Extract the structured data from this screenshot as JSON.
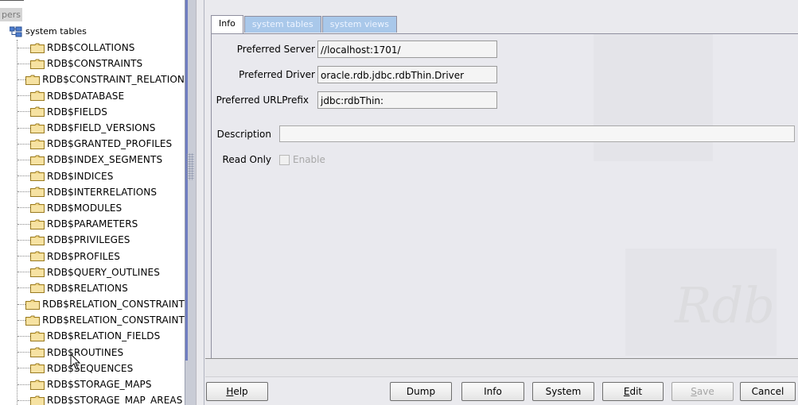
{
  "tree": {
    "pers_label": "pers",
    "root_label": "system tables",
    "items": [
      "RDB$COLLATIONS",
      "RDB$CONSTRAINTS",
      "RDB$CONSTRAINT_RELATION",
      "RDB$DATABASE",
      "RDB$FIELDS",
      "RDB$FIELD_VERSIONS",
      "RDB$GRANTED_PROFILES",
      "RDB$INDEX_SEGMENTS",
      "RDB$INDICES",
      "RDB$INTERRELATIONS",
      "RDB$MODULES",
      "RDB$PARAMETERS",
      "RDB$PRIVILEGES",
      "RDB$PROFILES",
      "RDB$QUERY_OUTLINES",
      "RDB$RELATIONS",
      "RDB$RELATION_CONSTRAINT",
      "RDB$RELATION_CONSTRAINT",
      "RDB$RELATION_FIELDS",
      "RDB$ROUTINES",
      "RDB$SEQUENCES",
      "RDB$STORAGE_MAPS",
      "RDB$STORAGE_MAP_AREAS"
    ]
  },
  "tabs": [
    "Info",
    "system tables",
    "system views"
  ],
  "form": {
    "preferred_server_label": "Preferred Server",
    "preferred_server_value": "//localhost:1701/",
    "preferred_driver_label": "Preferred Driver",
    "preferred_driver_value": "oracle.rdb.jdbc.rdbThin.Driver",
    "preferred_urlprefix_label": "Preferred URLPrefix",
    "preferred_urlprefix_value": "jdbc:rdbThin:",
    "description_label": "Description",
    "description_value": "",
    "read_only_label": "Read Only",
    "enable_label": "Enable"
  },
  "watermark": "Rdb",
  "buttons": {
    "help": {
      "u": "H",
      "rest": "elp"
    },
    "dump": "Dump",
    "info": "Info",
    "system": "System",
    "edit": {
      "u": "E",
      "rest": "dit"
    },
    "save": {
      "u": "S",
      "rest": "ave"
    },
    "cancel": "Cancel"
  },
  "colors": {
    "tab_inactive": "#a9c8ea",
    "folder": "#f3d98a",
    "splitter": "#6f7dc0"
  }
}
